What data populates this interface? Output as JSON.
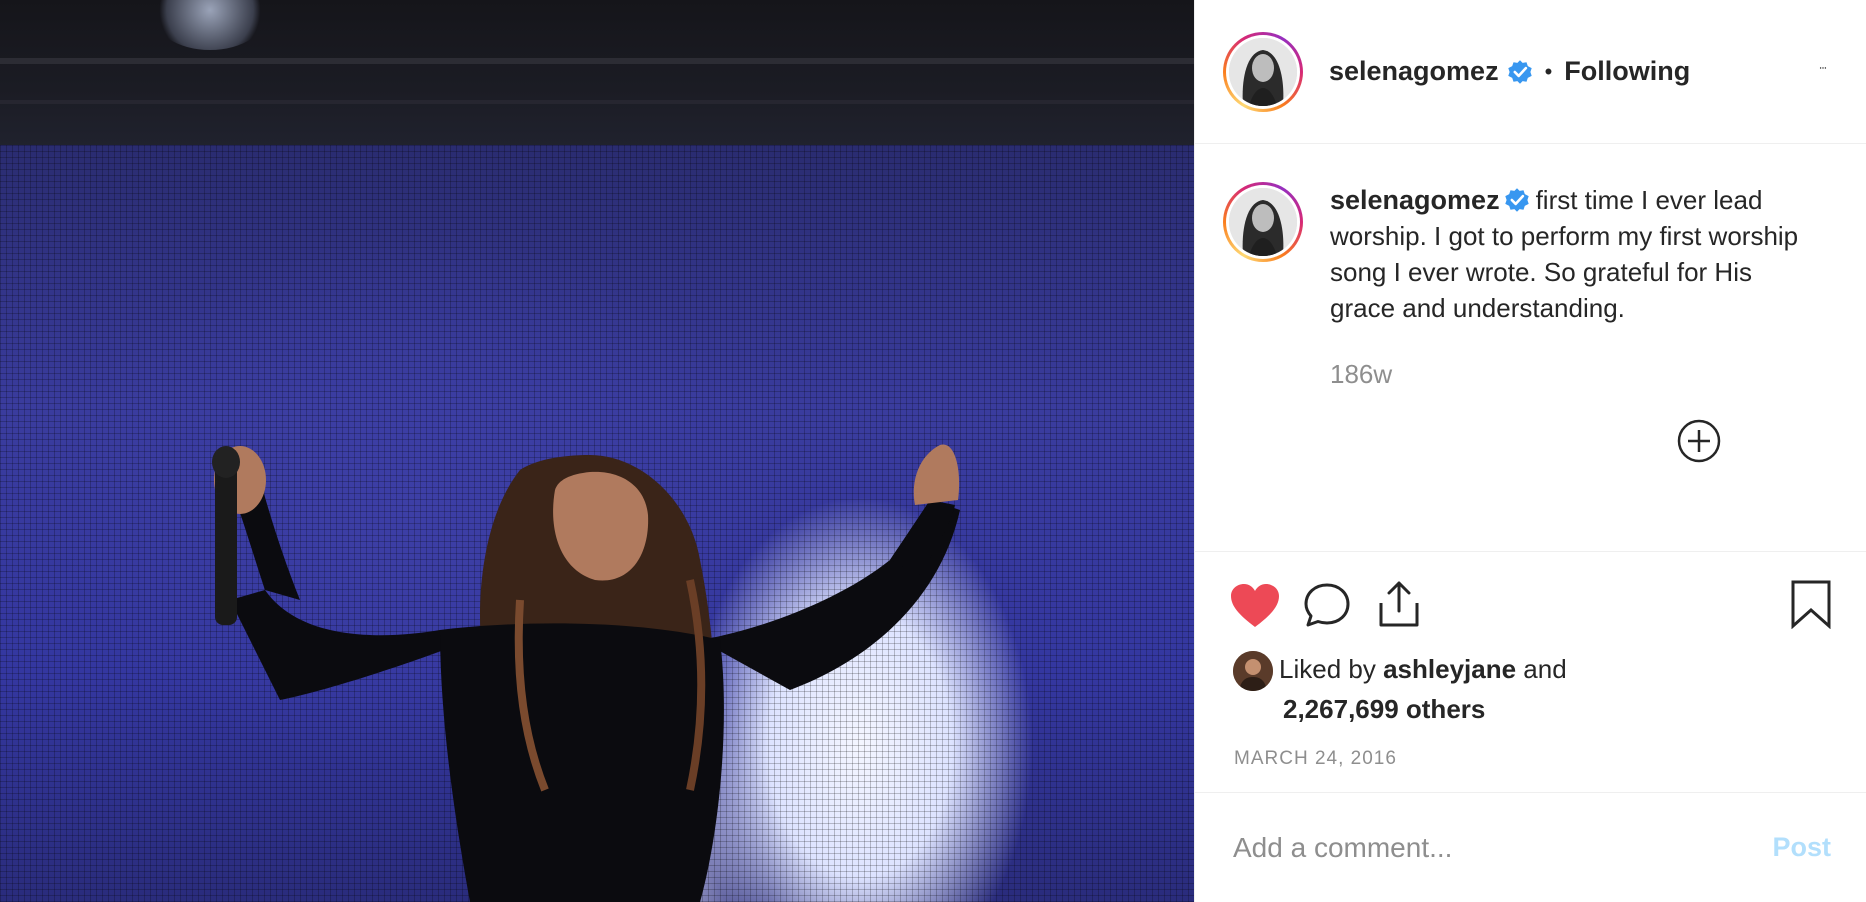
{
  "post": {
    "image_alt": "",
    "author": {
      "username": "selenagomez",
      "verified": true,
      "follow_status": "Following"
    },
    "separator": "•",
    "more_icon": "more-horizontal-icon",
    "caption": {
      "username": "selenagomez",
      "text": "first time I ever lead worship. I got to perform my first worship song I ever wrote. So grateful for His grace and understanding.",
      "age": "186w"
    },
    "actions": {
      "like_icon": "heart-filled-icon",
      "comment_icon": "comment-bubble-icon",
      "share_icon": "share-icon",
      "save_icon": "bookmark-icon",
      "liked": true
    },
    "likes": {
      "prefix": "Liked by",
      "user": "ashleyjane",
      "conjunction": "and",
      "others": "2,267,699 others"
    },
    "date": "MARCH 24, 2016",
    "comment_box": {
      "placeholder": "Add a comment...",
      "submit_label": "Post"
    },
    "colors": {
      "like_red": "#ed4956",
      "verified_blue": "#3897f0",
      "post_disabled": "#b2dffc"
    }
  }
}
